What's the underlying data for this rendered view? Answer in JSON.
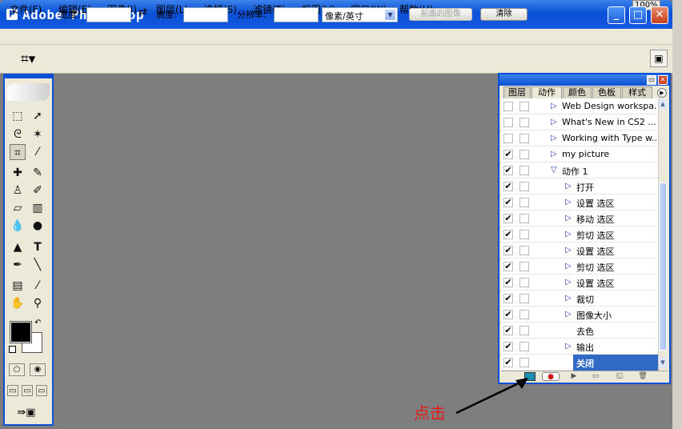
{
  "window": {
    "title": "Adobe Photoshop",
    "zoom_badge": "100%",
    "buttons": {
      "minimize": "_",
      "maximize": "□",
      "close": "✕"
    }
  },
  "menu": [
    "文件(F)",
    "编辑(E)",
    "图像(I)",
    "图层(L)",
    "选择(S)",
    "滤镜(T)",
    "视图(V)",
    "窗口(W)",
    "帮助(H)"
  ],
  "options": {
    "width_label": "宽度:",
    "swap_icon": "⇄",
    "height_label": "高度:",
    "resolution_label": "分辨率:",
    "unit_value": "像素/英寸",
    "front_image_button": "前面的图像",
    "clear_button": "清除"
  },
  "panel": {
    "tabs": [
      "图层",
      "动作",
      "颜色",
      "色板",
      "样式"
    ],
    "active_tab": "动作",
    "rows": [
      {
        "label": "Web Design workspa...",
        "checked": false,
        "expanded": false,
        "indent": 0
      },
      {
        "label": "What's New in CS2 ...",
        "checked": false,
        "expanded": false,
        "indent": 0
      },
      {
        "label": "Working with Type w...",
        "checked": false,
        "expanded": false,
        "indent": 0
      },
      {
        "label": "my picture",
        "checked": true,
        "expanded": false,
        "indent": 0
      },
      {
        "label": "动作 1",
        "checked": true,
        "expanded": true,
        "indent": 0
      },
      {
        "label": "打开",
        "checked": true,
        "expanded": false,
        "indent": 1
      },
      {
        "label": "设置 选区",
        "checked": true,
        "expanded": false,
        "indent": 1
      },
      {
        "label": "移动 选区",
        "checked": true,
        "expanded": false,
        "indent": 1
      },
      {
        "label": "剪切 选区",
        "checked": true,
        "expanded": false,
        "indent": 1
      },
      {
        "label": "设置 选区",
        "checked": true,
        "expanded": false,
        "indent": 1
      },
      {
        "label": "剪切 选区",
        "checked": true,
        "expanded": false,
        "indent": 1
      },
      {
        "label": "设置 选区",
        "checked": true,
        "expanded": false,
        "indent": 1
      },
      {
        "label": "裁切",
        "checked": true,
        "expanded": false,
        "indent": 1
      },
      {
        "label": "图像大小",
        "checked": true,
        "expanded": false,
        "indent": 1
      },
      {
        "label": "去色",
        "checked": true,
        "expanded": null,
        "indent": 1
      },
      {
        "label": "输出",
        "checked": true,
        "expanded": false,
        "indent": 1
      },
      {
        "label": "关闭",
        "checked": true,
        "expanded": null,
        "indent": 1,
        "selected": true
      }
    ]
  },
  "annotation": {
    "text": "点击"
  },
  "colors": {
    "titlebar": "#0a50d6",
    "selection": "#316ac5",
    "annotation": "#e41b1b",
    "canvas": "#7e7e7e"
  }
}
